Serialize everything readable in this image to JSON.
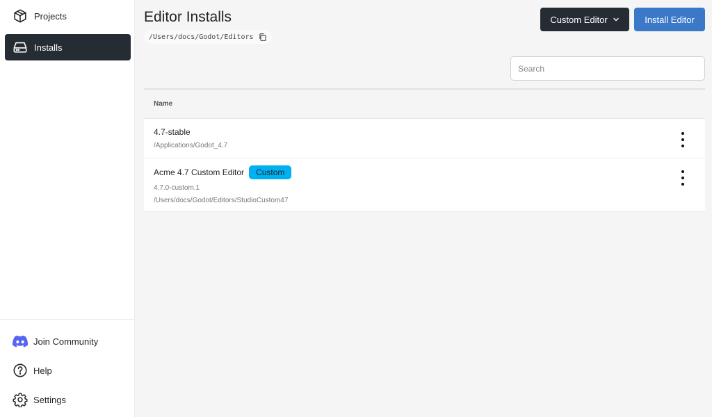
{
  "sidebar": {
    "items": [
      {
        "label": "Projects",
        "icon": "box-icon"
      },
      {
        "label": "Installs",
        "icon": "drive-icon",
        "active": true
      }
    ],
    "bottom": [
      {
        "label": "Join Community",
        "icon": "discord-icon",
        "color": "#5865f2"
      },
      {
        "label": "Help",
        "icon": "help-icon"
      },
      {
        "label": "Settings",
        "icon": "gear-icon"
      }
    ]
  },
  "header": {
    "title": "Editor Installs",
    "path": "/Users/docs/Godot/Editors",
    "custom_editor_label": "Custom Editor",
    "install_editor_label": "Install Editor"
  },
  "search": {
    "placeholder": "Search",
    "value": ""
  },
  "table": {
    "column_name": "Name",
    "rows": [
      {
        "name": "4.7-stable",
        "path": "/Applications/Godot_4.7"
      },
      {
        "name": "Acme 4.7 Custom Editor",
        "badge": "Custom",
        "version": "4.7.0-custom.1",
        "path": "/Users/docs/Godot/Editors/StudioCustom47"
      }
    ]
  },
  "colors": {
    "active_nav": "#262c33",
    "primary_button": "#3b78c8",
    "badge": "#00b1f2"
  }
}
